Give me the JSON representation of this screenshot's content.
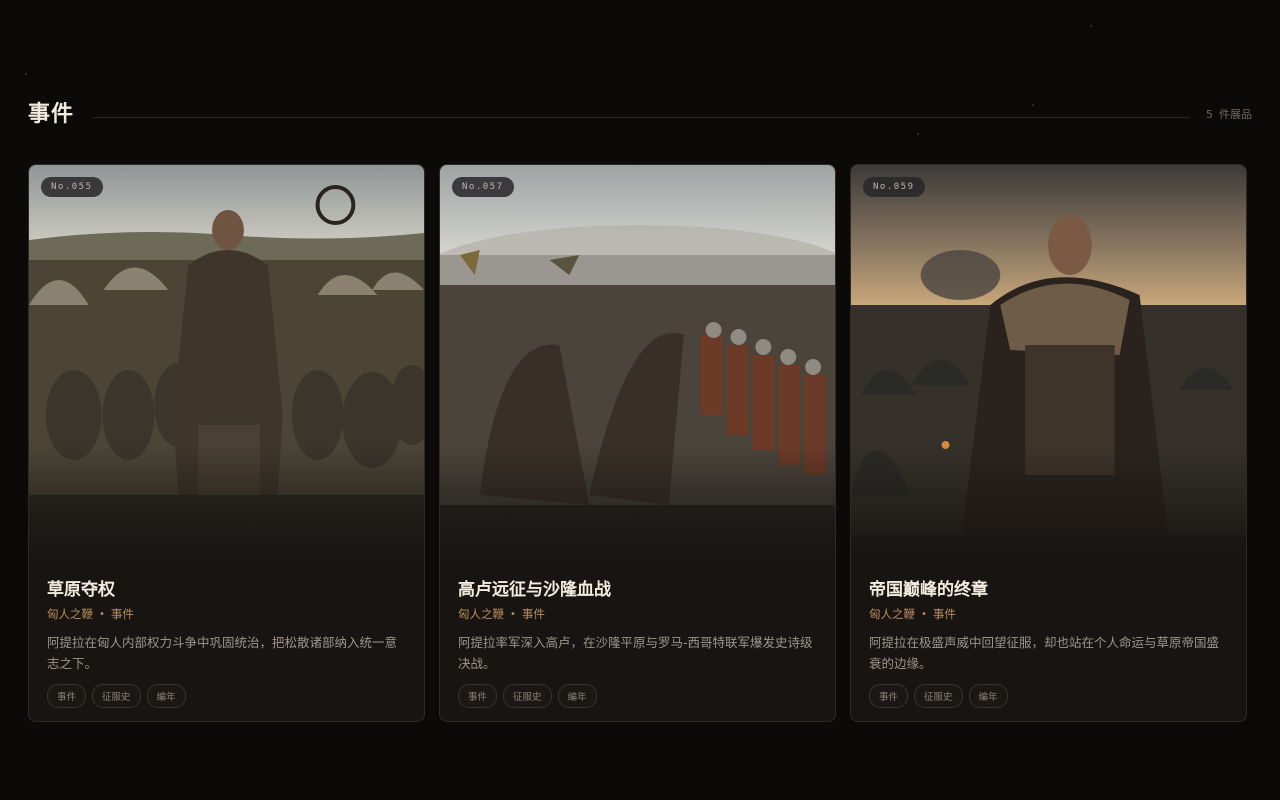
{
  "section": {
    "title": "事件",
    "count": "5",
    "count_label": "件展品"
  },
  "cards": [
    {
      "no": "No.055",
      "title": "草原夺权",
      "category": "匈人之鞭",
      "type": "事件",
      "desc": "阿提拉在匈人内部权力斗争中巩固统治，把松散诸部纳入统一意志之下。",
      "tags": [
        "事件",
        "征服史",
        "编年"
      ]
    },
    {
      "no": "No.057",
      "title": "高卢远征与沙隆血战",
      "category": "匈人之鞭",
      "type": "事件",
      "desc": "阿提拉率军深入高卢，在沙隆平原与罗马-西哥特联军爆发史诗级决战。",
      "tags": [
        "事件",
        "征服史",
        "编年"
      ]
    },
    {
      "no": "No.059",
      "title": "帝国巅峰的终章",
      "category": "匈人之鞭",
      "type": "事件",
      "desc": "阿提拉在极盛声威中回望征服，却也站在个人命运与草原帝国盛衰的边缘。",
      "tags": [
        "事件",
        "征服史",
        "编年"
      ]
    }
  ]
}
